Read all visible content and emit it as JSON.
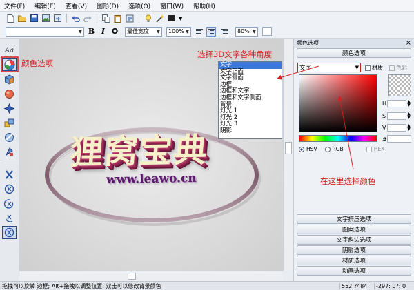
{
  "menu": [
    "文件(F)",
    "编辑(E)",
    "查看(V)",
    "图形(D)",
    "选项(O)",
    "窗口(W)",
    "帮助(H)"
  ],
  "toolbar": {
    "font_combo": "",
    "bold": "B",
    "italic": "I",
    "underline": "O",
    "weight_combo": "最佳宽度",
    "zoom_combo": "100%",
    "opacity_combo": "80%"
  },
  "left_tools": {
    "text_tool_label": "Aa"
  },
  "canvas": {
    "main_text": "狸窝宝典",
    "sub_text": "www.leawo.cn"
  },
  "dropdown": {
    "options": [
      "文字",
      "文字正面",
      "文字侧面",
      "边框",
      "边框和文字",
      "边框和文字侧面",
      "背景",
      "灯光 1",
      "灯光 2",
      "灯光 3",
      "阴影"
    ],
    "selected_index": 0
  },
  "right_panel": {
    "title": "颜色选项",
    "section_color": "颜色选项",
    "target_select": "文字",
    "checkbox_material": "材质",
    "checkbox_color": "色彩",
    "h_label": "H",
    "s_label": "S",
    "v_label": "V",
    "hash_label": "#",
    "radio_hsv": "HSV",
    "radio_rgb": "RGB",
    "check_hex": "HEX",
    "sections": [
      "文字挤压选项",
      "图案选项",
      "文字斜边选项",
      "阴影选项",
      "材质选项",
      "动画选项"
    ]
  },
  "status": {
    "hint": "拖拽可以旋转 边框; Alt+拖拽以调整位置; 双击可以修改背景颜色",
    "coords": "552 ?484",
    "angles": "-297: 0?: 0"
  },
  "annotations": {
    "color_option": "颜色选项",
    "angles": "选择3D文字各种角度",
    "pick_color": "在这里选择颜色"
  },
  "colors": {
    "annotation": "#d42020",
    "arrow": "#d42020",
    "text_face": "#f5f0c8",
    "text_side": "#8a2050",
    "ring": "#8a6878",
    "url_text": "#5a1b6a",
    "selection": "#3c78d8"
  }
}
